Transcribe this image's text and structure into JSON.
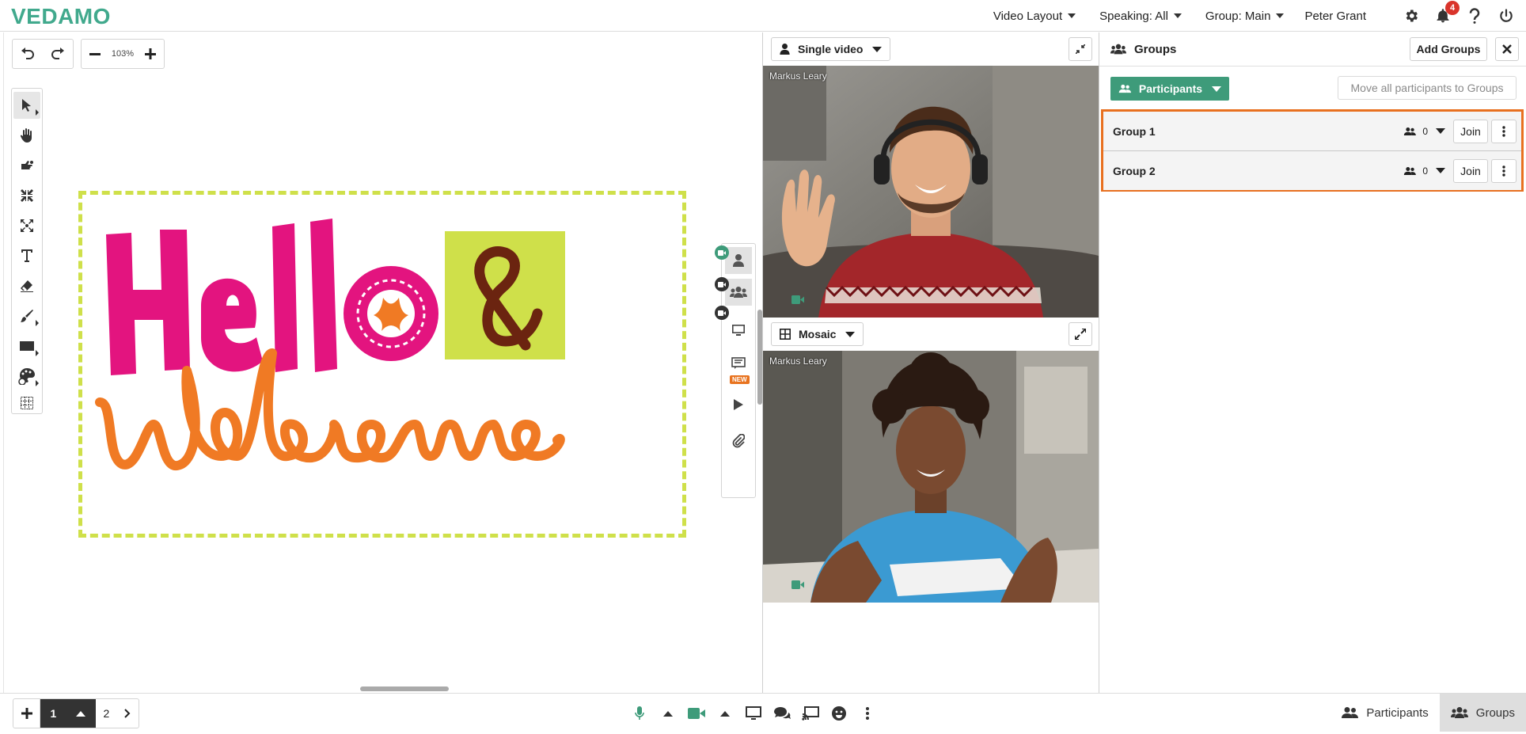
{
  "app": {
    "logo": "VEDAMO"
  },
  "topbar": {
    "video_layout": "Video Layout",
    "speaking": "Speaking: All",
    "group": "Group: Main",
    "user_name": "Peter Grant",
    "notification_count": "4"
  },
  "whiteboard": {
    "zoom": "103%",
    "tools": [
      "select-tool",
      "pan-tool",
      "laser-pointer-tool",
      "fit-tool",
      "zoom-area-tool",
      "text-tool",
      "eraser-tool",
      "brush-tool",
      "shape-tool",
      "color-tool",
      "grid-tool"
    ],
    "side_new_badge": "NEW",
    "image_alt": "Hello & welcome"
  },
  "video": {
    "top": {
      "mode": "Single video",
      "participant": "Markus Leary"
    },
    "bottom": {
      "mode": "Mosaic",
      "participant": "Markus Leary"
    }
  },
  "groups_panel": {
    "title": "Groups",
    "add_groups": "Add Groups",
    "participants_button": "Participants",
    "move_all": "Move all participants to Groups",
    "groups": [
      {
        "name": "Group 1",
        "count": "0",
        "join": "Join"
      },
      {
        "name": "Group 2",
        "count": "0",
        "join": "Join"
      }
    ]
  },
  "bottombar": {
    "current_page": "1",
    "next_page": "2",
    "tab_participants": "Participants",
    "tab_groups": "Groups"
  },
  "colors": {
    "brand": "#41a98d",
    "participants_button": "#3e9b7a",
    "highlight": "#e8701f",
    "badge": "#d9342b"
  }
}
